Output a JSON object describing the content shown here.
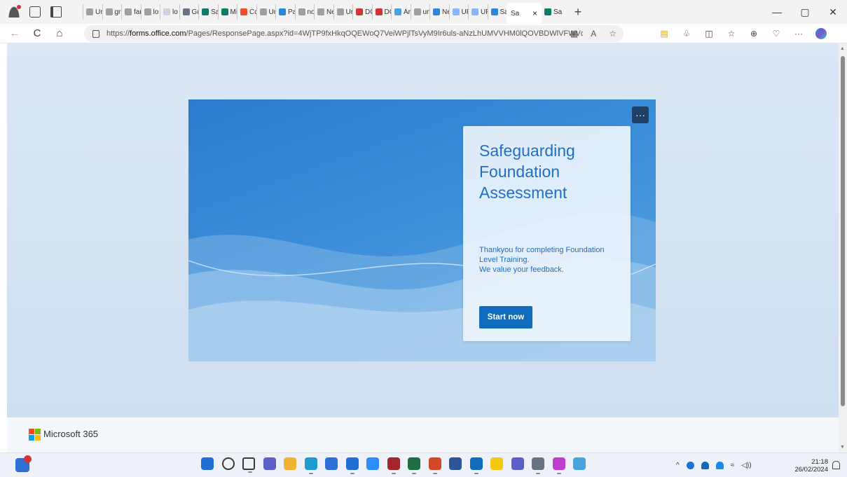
{
  "browser": {
    "tabs": [
      {
        "label": "Ur",
        "fav": "#9aa0a6"
      },
      {
        "label": "gr",
        "fav": "#9aa0a6"
      },
      {
        "label": "far",
        "fav": "#9aa0a6"
      },
      {
        "label": "lo",
        "fav": "#9aa0a6"
      },
      {
        "label": "lo",
        "fav": "#cbd5e1"
      },
      {
        "label": "Gu",
        "fav": "#6b7280"
      },
      {
        "label": "Sa",
        "fav": "#0e7c66"
      },
      {
        "label": "Mi",
        "fav": "#0e7c66"
      },
      {
        "label": "Cc",
        "fav": "#f25022"
      },
      {
        "label": "Ur",
        "fav": "#9aa0a6"
      },
      {
        "label": "Pa",
        "fav": "#2b88d8"
      },
      {
        "label": "no",
        "fav": "#9aa0a6"
      },
      {
        "label": "Ne",
        "fav": "#9aa0a6"
      },
      {
        "label": "Ur",
        "fav": "#9aa0a6"
      },
      {
        "label": "DC",
        "fav": "#d13438"
      },
      {
        "label": "DC",
        "fav": "#d13438"
      },
      {
        "label": "Ar",
        "fav": "#4aa3df"
      },
      {
        "label": "un",
        "fav": "#9aa0a6"
      },
      {
        "label": "Ne",
        "fav": "#2b88d8"
      },
      {
        "label": "UF",
        "fav": "#8ab4f8"
      },
      {
        "label": "UF",
        "fav": "#8ab4f8"
      },
      {
        "label": "Sa",
        "fav": "#2b88d8"
      }
    ],
    "active_tab": {
      "label": "Sa",
      "close": "×"
    },
    "extra_tab": {
      "label": "Sa",
      "fav": "#0e7c66"
    },
    "new_tab": "+",
    "window_controls": {
      "minimize": "—",
      "restore": "▢",
      "close": "✕"
    },
    "url_prefix": "https://",
    "url_host": "forms.office.com",
    "url_rest": "/Pages/ResponsePage.aspx?id=4WjTP9fxHkqOQEWoQ7VeiWPjlTsVyM9Ir6uls-aNzLhUMVVHM0lQOVBDWlVFWVd...",
    "nav": {
      "back": "←",
      "refresh": "C",
      "home": "⌂"
    },
    "addr_icons": {
      "reader": "▦",
      "read_aloud": "A",
      "favorite": "☆"
    },
    "toolbar_icons": {
      "ext1": "▤",
      "ext2": "♧",
      "split": "◫",
      "favorites": "☆",
      "collections": "⊕",
      "performance": "♡",
      "more": "···"
    }
  },
  "form": {
    "title": "Safeguarding Foundation Assessment",
    "message": "Thankyou for completing Foundation Level Training.\nWe value your feedback.",
    "start_label": "Start now",
    "more_label": "···"
  },
  "footer": {
    "brand": "Microsoft 365"
  },
  "taskbar": {
    "apps": [
      {
        "name": "start-icon",
        "color": "#1e6fd6"
      },
      {
        "name": "search-icon",
        "color": "#3a3a3a"
      },
      {
        "name": "task-view-icon",
        "color": "#3a3a3a"
      },
      {
        "name": "chat-icon",
        "color": "#5b5fc7"
      },
      {
        "name": "file-explorer-icon",
        "color": "#f2b233"
      },
      {
        "name": "edge-icon",
        "color": "#1f9bd1"
      },
      {
        "name": "store-icon",
        "color": "#2d6fd6"
      },
      {
        "name": "mail-icon",
        "color": "#1e6fd6"
      },
      {
        "name": "zoom-icon",
        "color": "#2d8cff"
      },
      {
        "name": "access-icon",
        "color": "#a4262c"
      },
      {
        "name": "excel-icon",
        "color": "#1d6f42"
      },
      {
        "name": "powerpoint-icon",
        "color": "#d24726"
      },
      {
        "name": "word-icon",
        "color": "#2b579a"
      },
      {
        "name": "outlook-icon",
        "color": "#0f6cbd"
      },
      {
        "name": "sticky-notes-icon",
        "color": "#f2c811"
      },
      {
        "name": "teams-icon",
        "color": "#5b5fc7"
      },
      {
        "name": "settings-icon",
        "color": "#6b7280"
      },
      {
        "name": "profile-sl-icon",
        "color": "#c13dd0"
      },
      {
        "name": "magnifier-icon",
        "color": "#4aa3df"
      }
    ],
    "tray_chevron": "^",
    "tray_sound": "◁))",
    "tray_wifi": "≈",
    "time": "21:18",
    "date": "26/02/2024"
  },
  "colors": {
    "accent": "#0f6cbd",
    "title": "#1f6fc3",
    "hero": "#2b7cd0"
  }
}
